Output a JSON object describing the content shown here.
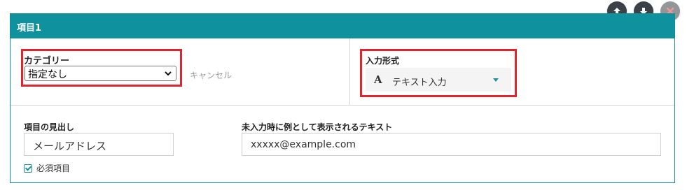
{
  "panel": {
    "title": "項目1"
  },
  "category": {
    "label": "カテゴリー",
    "selected": "指定なし",
    "cancel_label": "キャンセル"
  },
  "input_format": {
    "label": "入力形式",
    "icon_glyph": "A",
    "selected": "テキスト入力"
  },
  "item_heading": {
    "label": "項目の見出し",
    "value": "メールアドレス"
  },
  "placeholder_text": {
    "label": "未入力時に例として表示されるテキスト",
    "value": "xxxxx@example.com"
  },
  "required": {
    "label": "必須項目",
    "checked": true
  },
  "colors": {
    "header_bg": "#0f929d",
    "highlight_border": "#e0262d",
    "action_button_bg": "#3b4147",
    "delete_icon": "#e0463c"
  },
  "actions": {
    "move_up_icon": "arrow-up-icon",
    "move_down_icon": "arrow-down-icon",
    "delete_icon": "close-icon"
  }
}
